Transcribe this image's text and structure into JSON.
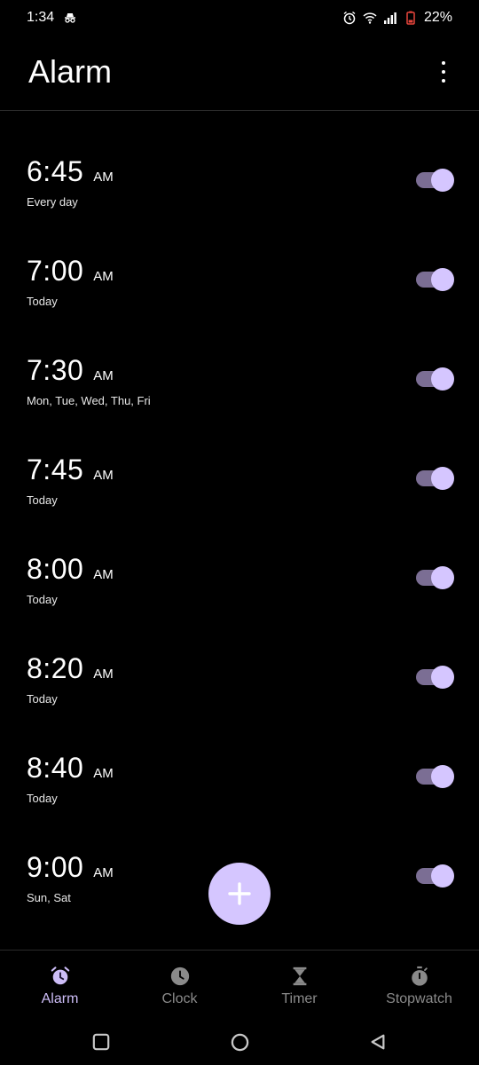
{
  "status_bar": {
    "time": "1:34",
    "battery": "22%"
  },
  "app_bar": {
    "title": "Alarm",
    "overflow_icon": "more-vertical-icon"
  },
  "alarms": [
    {
      "time": "6:45",
      "ampm": "AM",
      "days": "Every day",
      "enabled": true
    },
    {
      "time": "7:00",
      "ampm": "AM",
      "days": "Today",
      "enabled": true
    },
    {
      "time": "7:30",
      "ampm": "AM",
      "days": "Mon, Tue, Wed, Thu, Fri",
      "enabled": true
    },
    {
      "time": "7:45",
      "ampm": "AM",
      "days": "Today",
      "enabled": true
    },
    {
      "time": "8:00",
      "ampm": "AM",
      "days": "Today",
      "enabled": true
    },
    {
      "time": "8:20",
      "ampm": "AM",
      "days": "Today",
      "enabled": true
    },
    {
      "time": "8:40",
      "ampm": "AM",
      "days": "Today",
      "enabled": true
    },
    {
      "time": "9:00",
      "ampm": "AM",
      "days": "Sun, Sat",
      "enabled": true
    }
  ],
  "fab": {
    "icon": "plus-icon"
  },
  "bottom_nav": {
    "tabs": [
      {
        "label": "Alarm",
        "icon": "alarm-clock-icon",
        "active": true
      },
      {
        "label": "Clock",
        "icon": "clock-icon",
        "active": false
      },
      {
        "label": "Timer",
        "icon": "hourglass-icon",
        "active": false
      },
      {
        "label": "Stopwatch",
        "icon": "stopwatch-icon",
        "active": false
      }
    ]
  },
  "colors": {
    "background": "#000000",
    "accent": "#d5c6ff",
    "toggle_track": "#7b6e94",
    "inactive_nav": "#8a8a8a",
    "battery_low": "#e8453c"
  }
}
